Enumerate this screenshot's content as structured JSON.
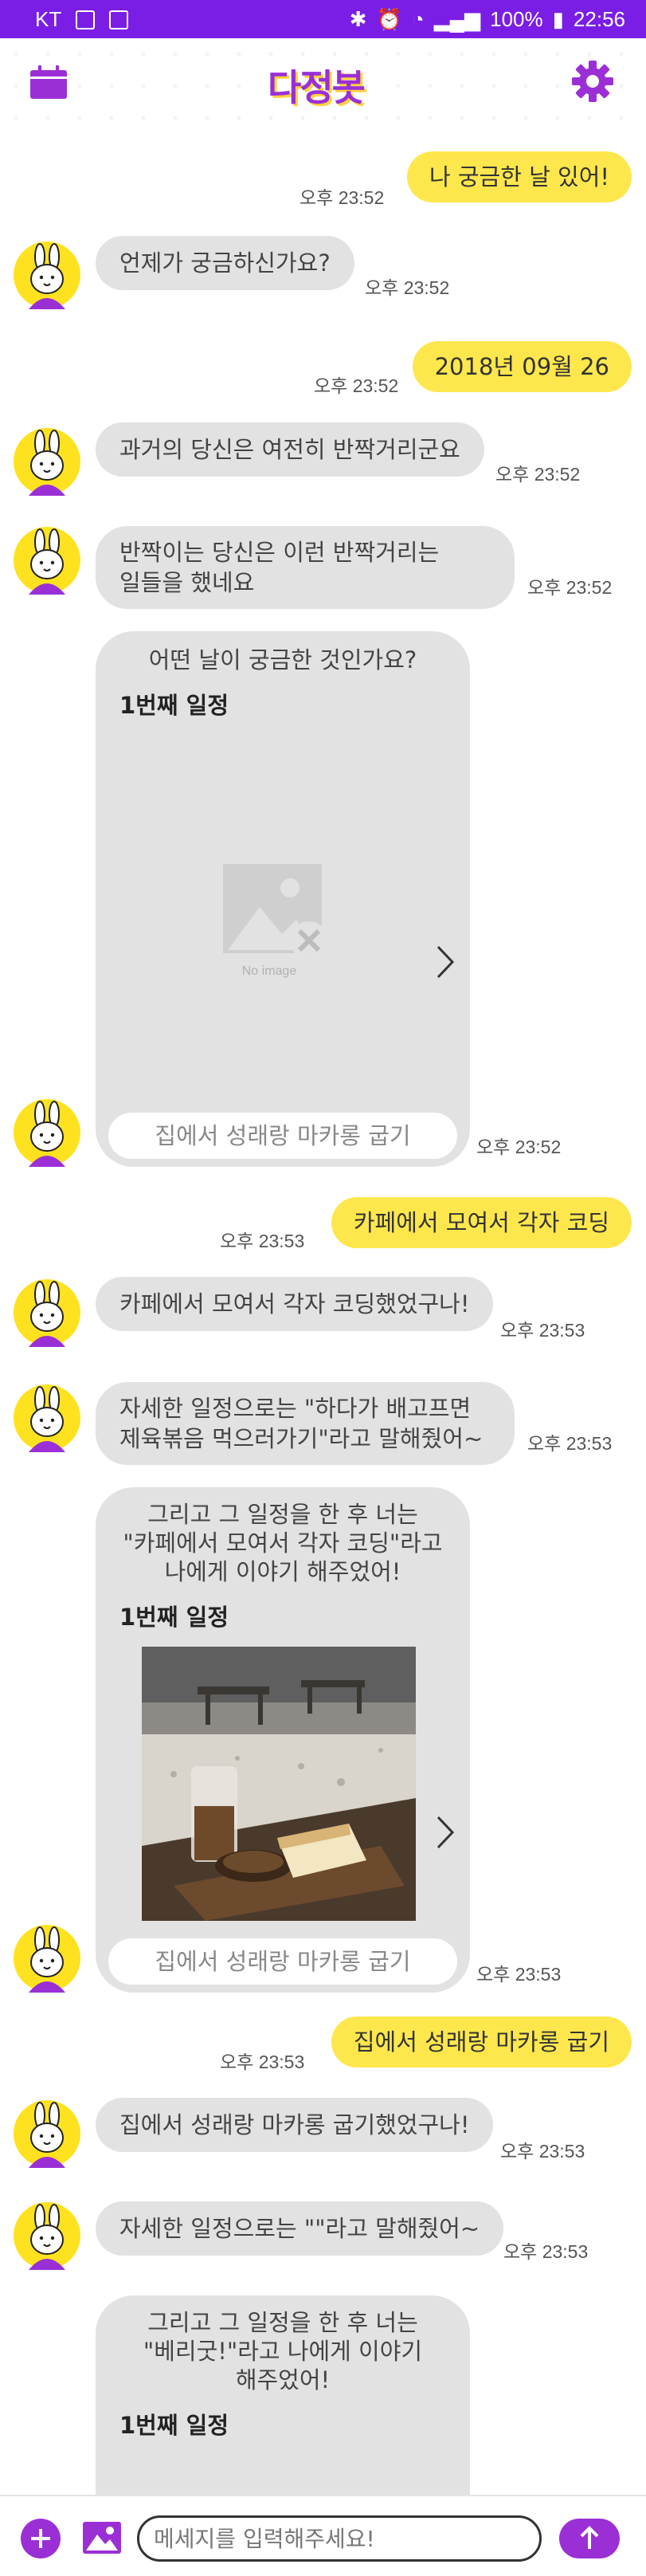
{
  "status_bar": {
    "carrier": "KT",
    "battery": "100%",
    "time": "22:56"
  },
  "header": {
    "logo_text": "다정봇",
    "left_icon": "calendar-icon",
    "right_icon": "gear-icon"
  },
  "colors": {
    "primary": "#9b2fd6",
    "status_bar": "#7a1ee6",
    "user_bubble": "#fde74c",
    "bot_bubble": "#e2e2e2"
  },
  "messages": [
    {
      "from": "user",
      "text": "나 궁금한 날 있어!",
      "time": "오후 23:52"
    },
    {
      "from": "bot",
      "text": "언제가 궁금하신가요?",
      "time": "오후 23:52"
    },
    {
      "from": "user",
      "text": "2018년 09월 26",
      "time": "오후 23:52"
    },
    {
      "from": "bot",
      "text": "과거의 당신은 여전히 반짝거리군요",
      "time": "오후 23:52"
    },
    {
      "from": "bot",
      "lines": [
        "반짝이는 당신은 이런 반짝거리는",
        "일들을 했네요"
      ],
      "time": "오후 23:52"
    },
    {
      "from": "bot_card",
      "lines": [
        "어떤 날이 궁금한 것인가요?"
      ],
      "schedule_label": "1번째 일정",
      "image": "no-image",
      "image_text": "No image",
      "caption": "집에서 성래랑 마카롱 굽기",
      "time": "오후 23:52"
    },
    {
      "from": "user",
      "text": "카페에서 모여서 각자 코딩",
      "time": "오후 23:53"
    },
    {
      "from": "bot",
      "text": "카페에서 모여서 각자 코딩했었구나!",
      "time": "오후 23:53"
    },
    {
      "from": "bot",
      "lines": [
        "자세한 일정으로는 \"하다가 배고프면",
        "제육볶음 먹으러가기\"라고 말해줬어~"
      ],
      "time": "오후 23:53"
    },
    {
      "from": "bot_card",
      "lines": [
        "그리고 그 일정을 한 후 너는",
        "\"카페에서 모여서 각자 코딩\"라고",
        "나에게 이야기 해주었어!"
      ],
      "schedule_label": "1번째 일정",
      "image": "cafe-photo",
      "caption": "집에서 성래랑 마카롱 굽기",
      "time": "오후 23:53"
    },
    {
      "from": "user",
      "text": "집에서 성래랑 마카롱 굽기",
      "time": "오후 23:53"
    },
    {
      "from": "bot",
      "text": "집에서 성래랑 마카롱 굽기했었구나!",
      "time": "오후 23:53"
    },
    {
      "from": "bot",
      "text": "자세한 일정으로는 \"\"라고 말해줬어~",
      "time": "오후 23:53"
    },
    {
      "from": "bot_card",
      "lines": [
        "그리고 그 일정을 한 후 너는",
        "\"베리굿!\"라고 나에게 이야기",
        "해주었어!"
      ],
      "schedule_label": "1번째 일정"
    }
  ],
  "input_bar": {
    "placeholder": "메세지를 입력해주세요!",
    "add_icon": "plus-icon",
    "image_icon": "image-icon",
    "send_icon": "arrow-up-icon"
  }
}
